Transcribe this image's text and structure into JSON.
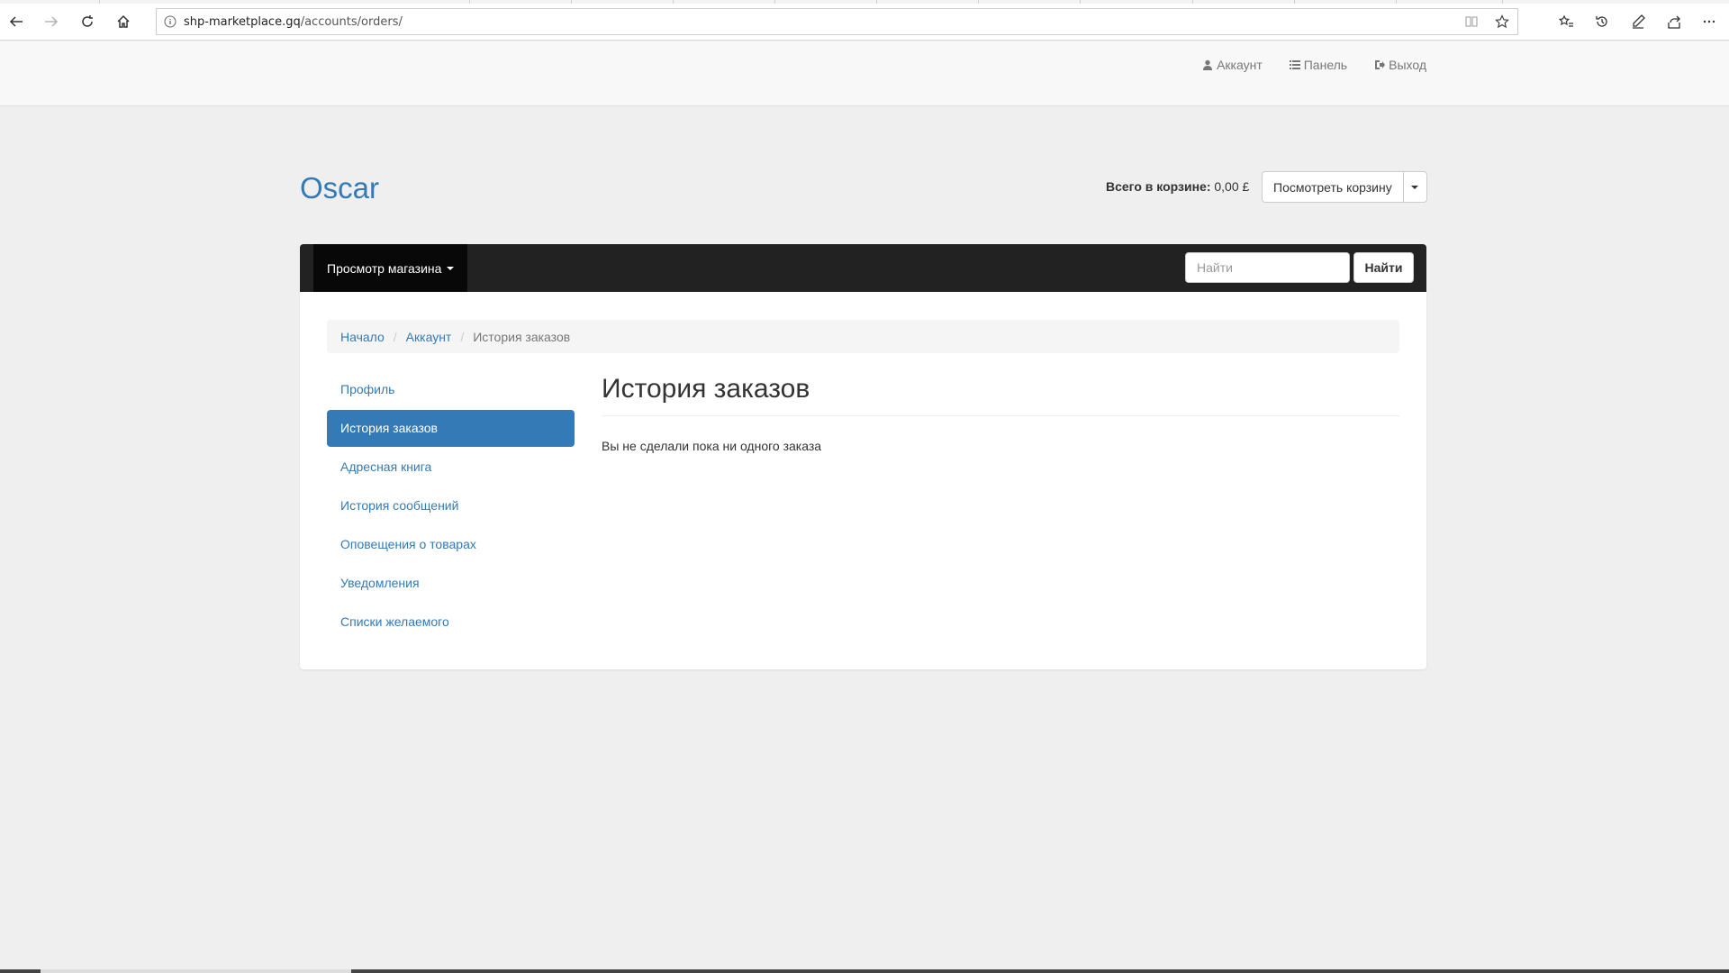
{
  "browser": {
    "url_host": "shp-marketplace.gq",
    "url_path": "/accounts/orders/"
  },
  "top_links": {
    "account": "Аккаунт",
    "dashboard": "Панель",
    "logout": "Выход"
  },
  "brand": "Oscar",
  "basket": {
    "label": "Всего в корзине:",
    "total": "0,00 £",
    "view_button": "Посмотреть корзину"
  },
  "navbar": {
    "browse_label": "Просмотр магазина",
    "search_placeholder": "Найти",
    "search_button": "Найти"
  },
  "breadcrumb": {
    "home": "Начало",
    "account": "Аккаунт",
    "current": "История заказов"
  },
  "sidebar": {
    "items": [
      {
        "label": "Профиль"
      },
      {
        "label": "История заказов"
      },
      {
        "label": "Адресная книга"
      },
      {
        "label": "История сообщений"
      },
      {
        "label": "Оповещения о товарах"
      },
      {
        "label": "Уведомления"
      },
      {
        "label": "Списки желаемого"
      }
    ],
    "active_index": 1
  },
  "main": {
    "title": "История заказов",
    "empty_message": "Вы не сделали пока ни одного заказа"
  },
  "colors": {
    "link": "#337ab7",
    "navbar": "#222222",
    "active_item": "#337ab7"
  }
}
